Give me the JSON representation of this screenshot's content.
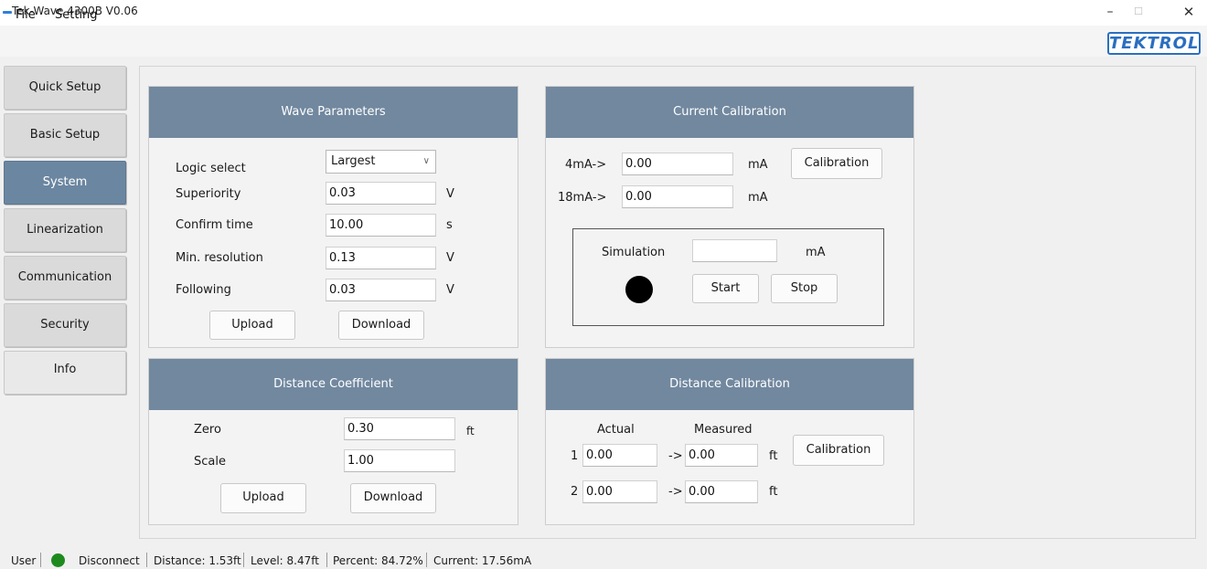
{
  "window": {
    "title": "Tek-Wave 4300B V0.06",
    "minimize": "–",
    "maximize": "☐",
    "close": "✕"
  },
  "menu": {
    "file": "File",
    "setting": "Setting"
  },
  "logo": "TEKTROL",
  "nav": {
    "quick_setup": "Quick Setup",
    "basic_setup": "Basic Setup",
    "system": "System",
    "linearization": "Linearization",
    "communication": "Communication",
    "security": "Security",
    "info": "Info"
  },
  "wave_parameters": {
    "title": "Wave Parameters",
    "logic_select_label": "Logic select",
    "logic_select_value": "Largest",
    "superiority_label": "Superiority",
    "superiority_value": "0.03",
    "superiority_unit": "V",
    "confirm_time_label": "Confirm time",
    "confirm_time_value": "10.00",
    "confirm_time_unit": "s",
    "min_resolution_label": "Min. resolution",
    "min_resolution_value": "0.13",
    "min_resolution_unit": "V",
    "following_label": "Following",
    "following_value": "0.03",
    "following_unit": "V",
    "upload": "Upload",
    "download": "Download"
  },
  "current_calibration": {
    "title": "Current Calibration",
    "ma4_label": "4mA->",
    "ma4_value": "0.00",
    "ma4_unit": "mA",
    "ma18_label": "18mA->",
    "ma18_value": "0.00",
    "ma18_unit": "mA",
    "calibration": "Calibration",
    "simulation_label": "Simulation",
    "simulation_value": "",
    "simulation_unit": "mA",
    "start": "Start",
    "stop": "Stop"
  },
  "distance_coefficient": {
    "title": "Distance Coefficient",
    "zero_label": "Zero",
    "zero_value": "0.30",
    "zero_unit": "ft",
    "scale_label": "Scale",
    "scale_value": "1.00",
    "upload": "Upload",
    "download": "Download"
  },
  "distance_calibration": {
    "title": "Distance Calibration",
    "actual_header": "Actual",
    "measured_header": "Measured",
    "rows": [
      {
        "index": "1",
        "actual": "0.00",
        "arrow": "->",
        "measured": "0.00",
        "unit": "ft"
      },
      {
        "index": "2",
        "actual": "0.00",
        "arrow": "->",
        "measured": "0.00",
        "unit": "ft"
      }
    ],
    "calibration": "Calibration"
  },
  "status": {
    "user": "User",
    "connection": "Disconnect",
    "distance": "Distance:  1.53ft",
    "level": "Level:  8.47ft",
    "percent": "Percent:  84.72%",
    "current": "Current:  17.56mA",
    "indicator_color": "#1e8a1e"
  }
}
